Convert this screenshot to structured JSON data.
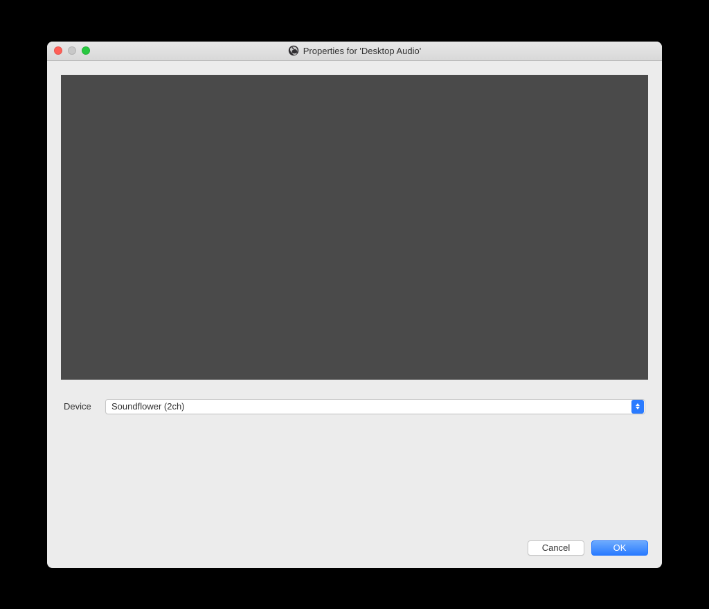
{
  "window": {
    "title": "Properties for 'Desktop Audio'",
    "app_icon_name": "obs-icon"
  },
  "form": {
    "device_label": "Device",
    "device_selected": "Soundflower (2ch)"
  },
  "buttons": {
    "cancel": "Cancel",
    "ok": "OK"
  },
  "colors": {
    "accent": "#2a7bff",
    "window_bg": "#ececec",
    "preview_bg": "#4a4a4a"
  }
}
